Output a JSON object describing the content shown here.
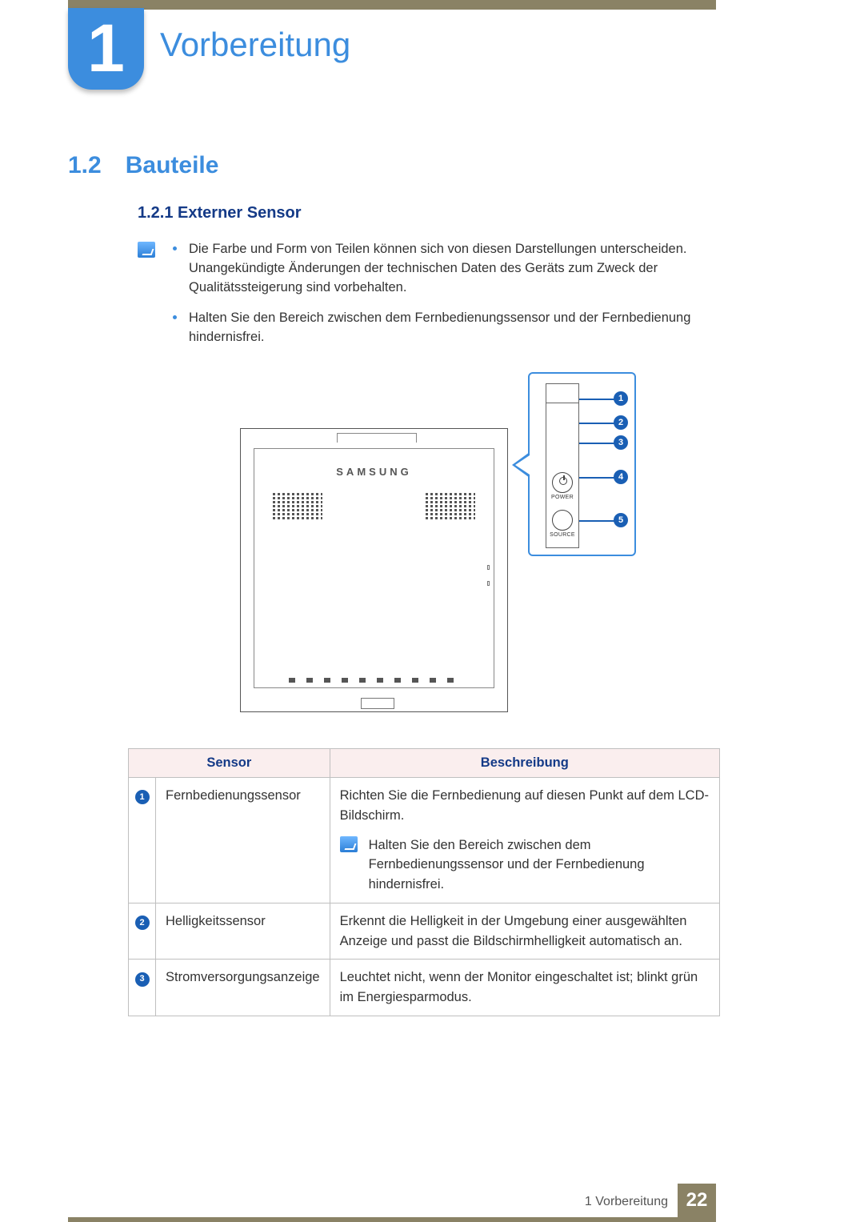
{
  "chapter": {
    "number": "1",
    "title": "Vorbereitung"
  },
  "section": {
    "number": "1.2",
    "title": "Bauteile"
  },
  "subsection": {
    "number": "1.2.1",
    "title": "Externer Sensor"
  },
  "notes": {
    "bullet1": "Die Farbe und Form von Teilen können sich von diesen Darstellungen unterscheiden. Unangekündigte Änderungen der technischen Daten des Geräts zum Zweck der Qualitätssteigerung sind vorbehalten.",
    "bullet2": "Halten Sie den Bereich zwischen dem Fernbedienungssensor und der Fernbedienung hindernisfrei."
  },
  "diagram": {
    "brand": "SAMSUNG",
    "buttons": {
      "power": "POWER",
      "source": "SOURCE"
    },
    "callouts": [
      "1",
      "2",
      "3",
      "4",
      "5"
    ]
  },
  "table": {
    "headers": {
      "sensor": "Sensor",
      "desc": "Beschreibung"
    },
    "rows": [
      {
        "num": "1",
        "name": "Fernbedienungssensor",
        "desc": "Richten Sie die Fernbedienung auf diesen Punkt auf dem LCD-Bildschirm.",
        "note": "Halten Sie den Bereich zwischen dem Fernbedienungssensor und der Fernbedienung hindernisfrei."
      },
      {
        "num": "2",
        "name": "Helligkeitssensor",
        "desc": "Erkennt die Helligkeit in der Umgebung einer ausgewählten Anzeige und passt die Bildschirmhelligkeit automatisch an."
      },
      {
        "num": "3",
        "name": "Stromversorgungsanzeige",
        "desc": "Leuchtet nicht, wenn der Monitor eingeschaltet ist; blinkt grün im Energiesparmodus."
      }
    ]
  },
  "footer": {
    "label": "1 Vorbereitung",
    "page": "22"
  }
}
